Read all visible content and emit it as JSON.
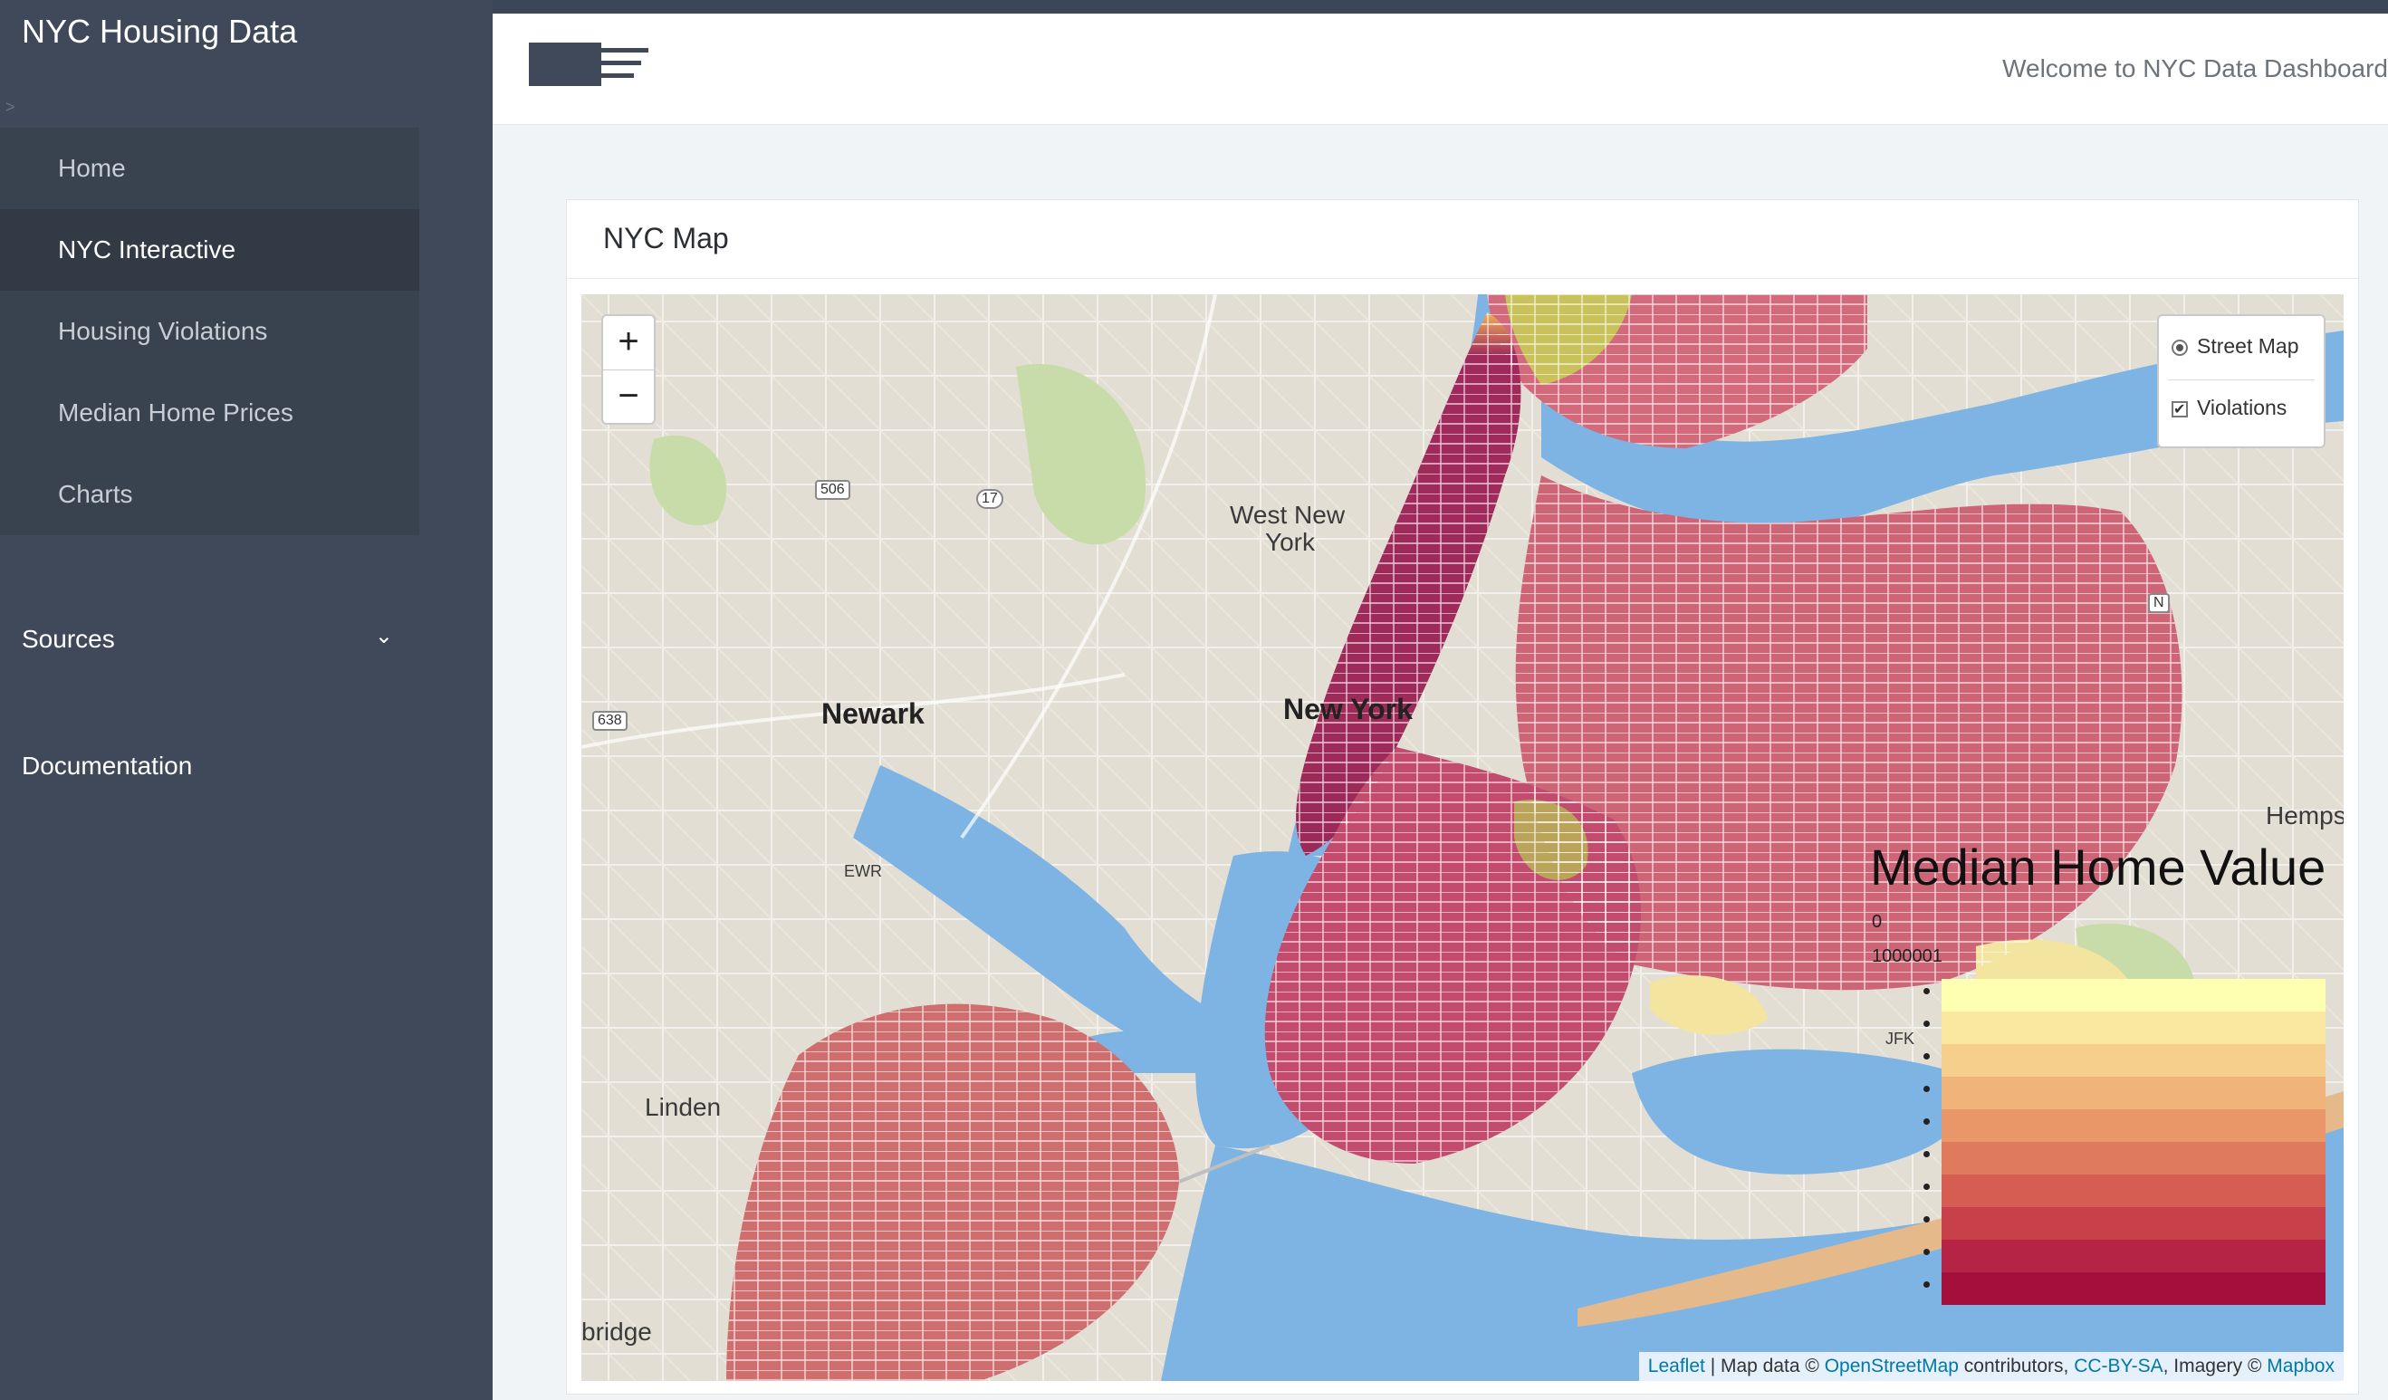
{
  "sidebar": {
    "brand": "NYC Housing Data",
    "caret": ">",
    "nav_items": [
      {
        "label": "Home"
      },
      {
        "label": "NYC Interactive"
      },
      {
        "label": "Housing Violations"
      },
      {
        "label": "Median Home Prices"
      },
      {
        "label": "Charts"
      }
    ],
    "active_index": 1,
    "sources_label": "Sources",
    "docs_label": "Documentation"
  },
  "header": {
    "menu_icon": "hamburger-icon",
    "welcome": "Welcome to NYC Data Dashboard"
  },
  "card": {
    "title": "NYC Map"
  },
  "map": {
    "zoom_in": "+",
    "zoom_out": "−",
    "layers": {
      "base": "Street Map",
      "overlay": "Violations",
      "base_selected": true,
      "overlay_checked": true
    },
    "labels": {
      "west_new_york_1": "West New",
      "west_new_york_2": "York",
      "newark": "Newark",
      "new_york": "New York",
      "linden": "Linden",
      "bridge": "bridge",
      "hemps": "Hemps",
      "ewr": "EWR",
      "jfk": "JFK",
      "shield_506": "506",
      "shield_17": "17",
      "shield_638": "638",
      "shield_n": "N"
    },
    "legend": {
      "title": "Median Home Value",
      "min": "0",
      "max": "1000001",
      "colors": [
        "#ffffb2",
        "#fbe8a0",
        "#f6cf8d",
        "#f0b47a",
        "#e99769",
        "#e07a5c",
        "#d55d52",
        "#c7404a",
        "#b52444",
        "#a50f3c"
      ]
    },
    "attribution": {
      "leaflet": "Leaflet",
      "sep1": " | Map data © ",
      "osm": "OpenStreetMap",
      "sep2": " contributors, ",
      "cc": "CC-BY-SA",
      "sep3": ", Imagery © ",
      "mapbox": "Mapbox"
    }
  },
  "colors": {
    "sidebar_bg": "#3f4959",
    "water": "#7db4e3",
    "land": "#dfdcd3"
  }
}
